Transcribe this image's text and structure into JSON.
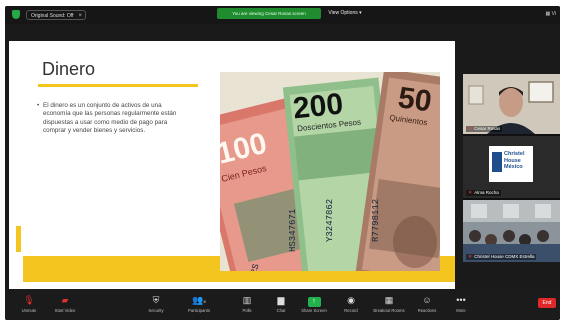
{
  "topbar": {
    "audio_pill": "Original Sound: Off",
    "share_banner": "You are viewing Cesar Rosas screen",
    "view_options": "View Options ▾",
    "view_right": "▦ Vi"
  },
  "slide": {
    "title": "Dinero",
    "bullet": "El dinero es un conjunto de activos de una economía que las personas regularmente están dispuestas a usar como medio de pago para comprar y vender bienes y servicios.",
    "notes": {
      "n1": "100",
      "n1_word": "Cien Pesos",
      "n2": "200",
      "n2_word": "Doscientos Pesos",
      "n3": "50",
      "n3_word": "Quinientos",
      "serial1": "HS347671",
      "serial2": "Y3247862",
      "serial3": "R7798112",
      "serial4": "S78872S"
    }
  },
  "participants": [
    {
      "name": "Cesar Rosas"
    },
    {
      "name": "Alma Rocha",
      "logo": [
        "Christel",
        "House",
        "México"
      ]
    },
    {
      "name": "Christel House CDMX Estrella"
    }
  ],
  "toolbar": {
    "unmute": "Unmute",
    "start_video": "Start Video",
    "security": "Security",
    "participants": "Participants",
    "participants_count": "8",
    "polls": "Polls",
    "chat": "Chat",
    "share_screen": "Share Screen",
    "record": "Record",
    "breakout": "Breakout Rooms",
    "reactions": "Reactions",
    "more": "More",
    "end": "End"
  }
}
